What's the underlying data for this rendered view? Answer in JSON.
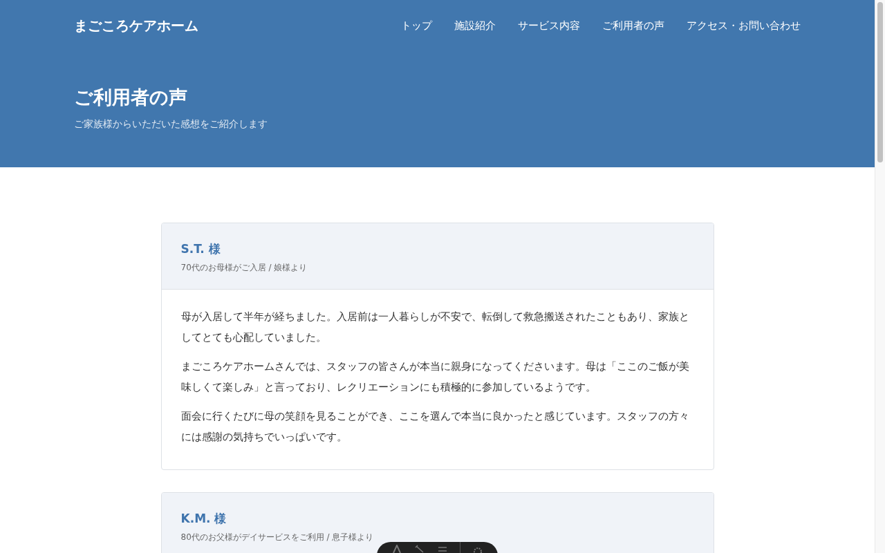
{
  "header": {
    "logo": "まごころケアホーム",
    "nav": [
      {
        "label": "トップ"
      },
      {
        "label": "施設紹介"
      },
      {
        "label": "サービス内容"
      },
      {
        "label": "ご利用者の声"
      },
      {
        "label": "アクセス・お問い合わせ"
      }
    ]
  },
  "hero": {
    "title": "ご利用者の声",
    "subtitle": "ご家族様からいただいた感想をご紹介します"
  },
  "testimonials": [
    {
      "name": "S.T. 様",
      "meta": "70代のお母様がご入居 / 娘様より",
      "paragraphs": [
        "母が入居して半年が経ちました。入居前は一人暮らしが不安で、転倒して救急搬送されたこともあり、家族としてとても心配していました。",
        "まごころケアホームさんでは、スタッフの皆さんが本当に親身になってくださいます。母は「ここのご飯が美味しくて楽しみ」と言っており、レクリエーションにも積極的に参加しているようです。",
        "面会に行くたびに母の笑顔を見ることができ、ここを選んで本当に良かったと感じています。スタッフの方々には感謝の気持ちでいっぱいです。"
      ]
    },
    {
      "name": "K.M. 様",
      "meta": "80代のお父様がデイサービスをご利用 / 息子様より"
    }
  ]
}
